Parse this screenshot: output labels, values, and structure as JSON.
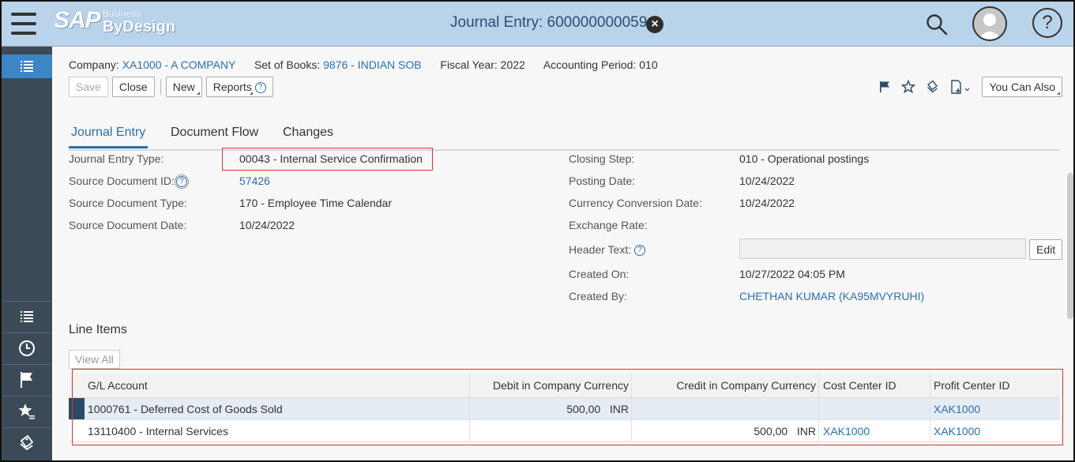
{
  "shell": {
    "brand_sap": "SAP",
    "brand_business": "Business",
    "brand_bydesign": "ByDesign",
    "title": "Journal Entry: 600000000059",
    "close_icon": "close-circle-icon",
    "search_icon": "search-icon",
    "user_icon": "avatar-icon",
    "help_label": "?"
  },
  "context": {
    "company_label": "Company:",
    "company_value": "XA1000 - A COMPANY",
    "books_label": "Set of Books:",
    "books_value": "9876 - INDIAN SOB",
    "fiscal_label": "Fiscal Year:",
    "fiscal_value": "2022",
    "period_label": "Accounting Period:",
    "period_value": "010"
  },
  "toolbar": {
    "save": "Save",
    "close": "Close",
    "new": "New",
    "reports": "Reports",
    "you_can_also": "You Can Also"
  },
  "tabs": [
    "Journal Entry",
    "Document Flow",
    "Changes"
  ],
  "left_fields": [
    {
      "label": "Journal Entry Type:",
      "value": "00043 - Internal Service Confirmation"
    },
    {
      "label": "Source Document ID:",
      "value": "57426"
    },
    {
      "label": "Source Document Type:",
      "value": "170 - Employee Time Calendar"
    },
    {
      "label": "Source Document Date:",
      "value": "10/24/2022"
    }
  ],
  "right_fields": [
    {
      "label": "Closing Step:",
      "value": "010 - Operational postings"
    },
    {
      "label": "Posting Date:",
      "value": "10/24/2022"
    },
    {
      "label": "Currency Conversion Date:",
      "value": "10/24/2022"
    },
    {
      "label": "Exchange Rate:",
      "value": ""
    },
    {
      "label": "Header Text:",
      "value": "",
      "button": "Edit"
    },
    {
      "label": "Created On:",
      "value": "10/27/2022 04:05 PM"
    },
    {
      "label": "Created By:",
      "value": "CHETHAN KUMAR (KA95MVYRUHI)"
    }
  ],
  "line_items": {
    "title": "Line Items",
    "view_all": "View All",
    "columns": [
      "G/L Account",
      "Debit in Company Currency",
      "Credit in Company Currency",
      "Cost Center ID",
      "Profit Center ID"
    ],
    "rows": [
      {
        "gl": "1000761 - Deferred Cost of Goods Sold",
        "debit": "500,00",
        "debit_cur": "INR",
        "credit": "",
        "credit_cur": "",
        "cost_center": "",
        "profit_center": "XAK1000"
      },
      {
        "gl": "13110400 - Internal Services",
        "debit": "",
        "debit_cur": "",
        "credit": "500,00",
        "credit_cur": "INR",
        "cost_center": "XAK1000",
        "profit_center": "XAK1000"
      }
    ]
  },
  "sidebar_icons": [
    "list-icon",
    "list-icon",
    "history-clock-icon",
    "flag-icon",
    "favorites-star-icon",
    "tag-icon"
  ],
  "colors": {
    "shell_bg": "#b9d3ea",
    "sidebar_bg": "#3c4a58",
    "link": "#2a6fae",
    "highlight": "#d33"
  }
}
